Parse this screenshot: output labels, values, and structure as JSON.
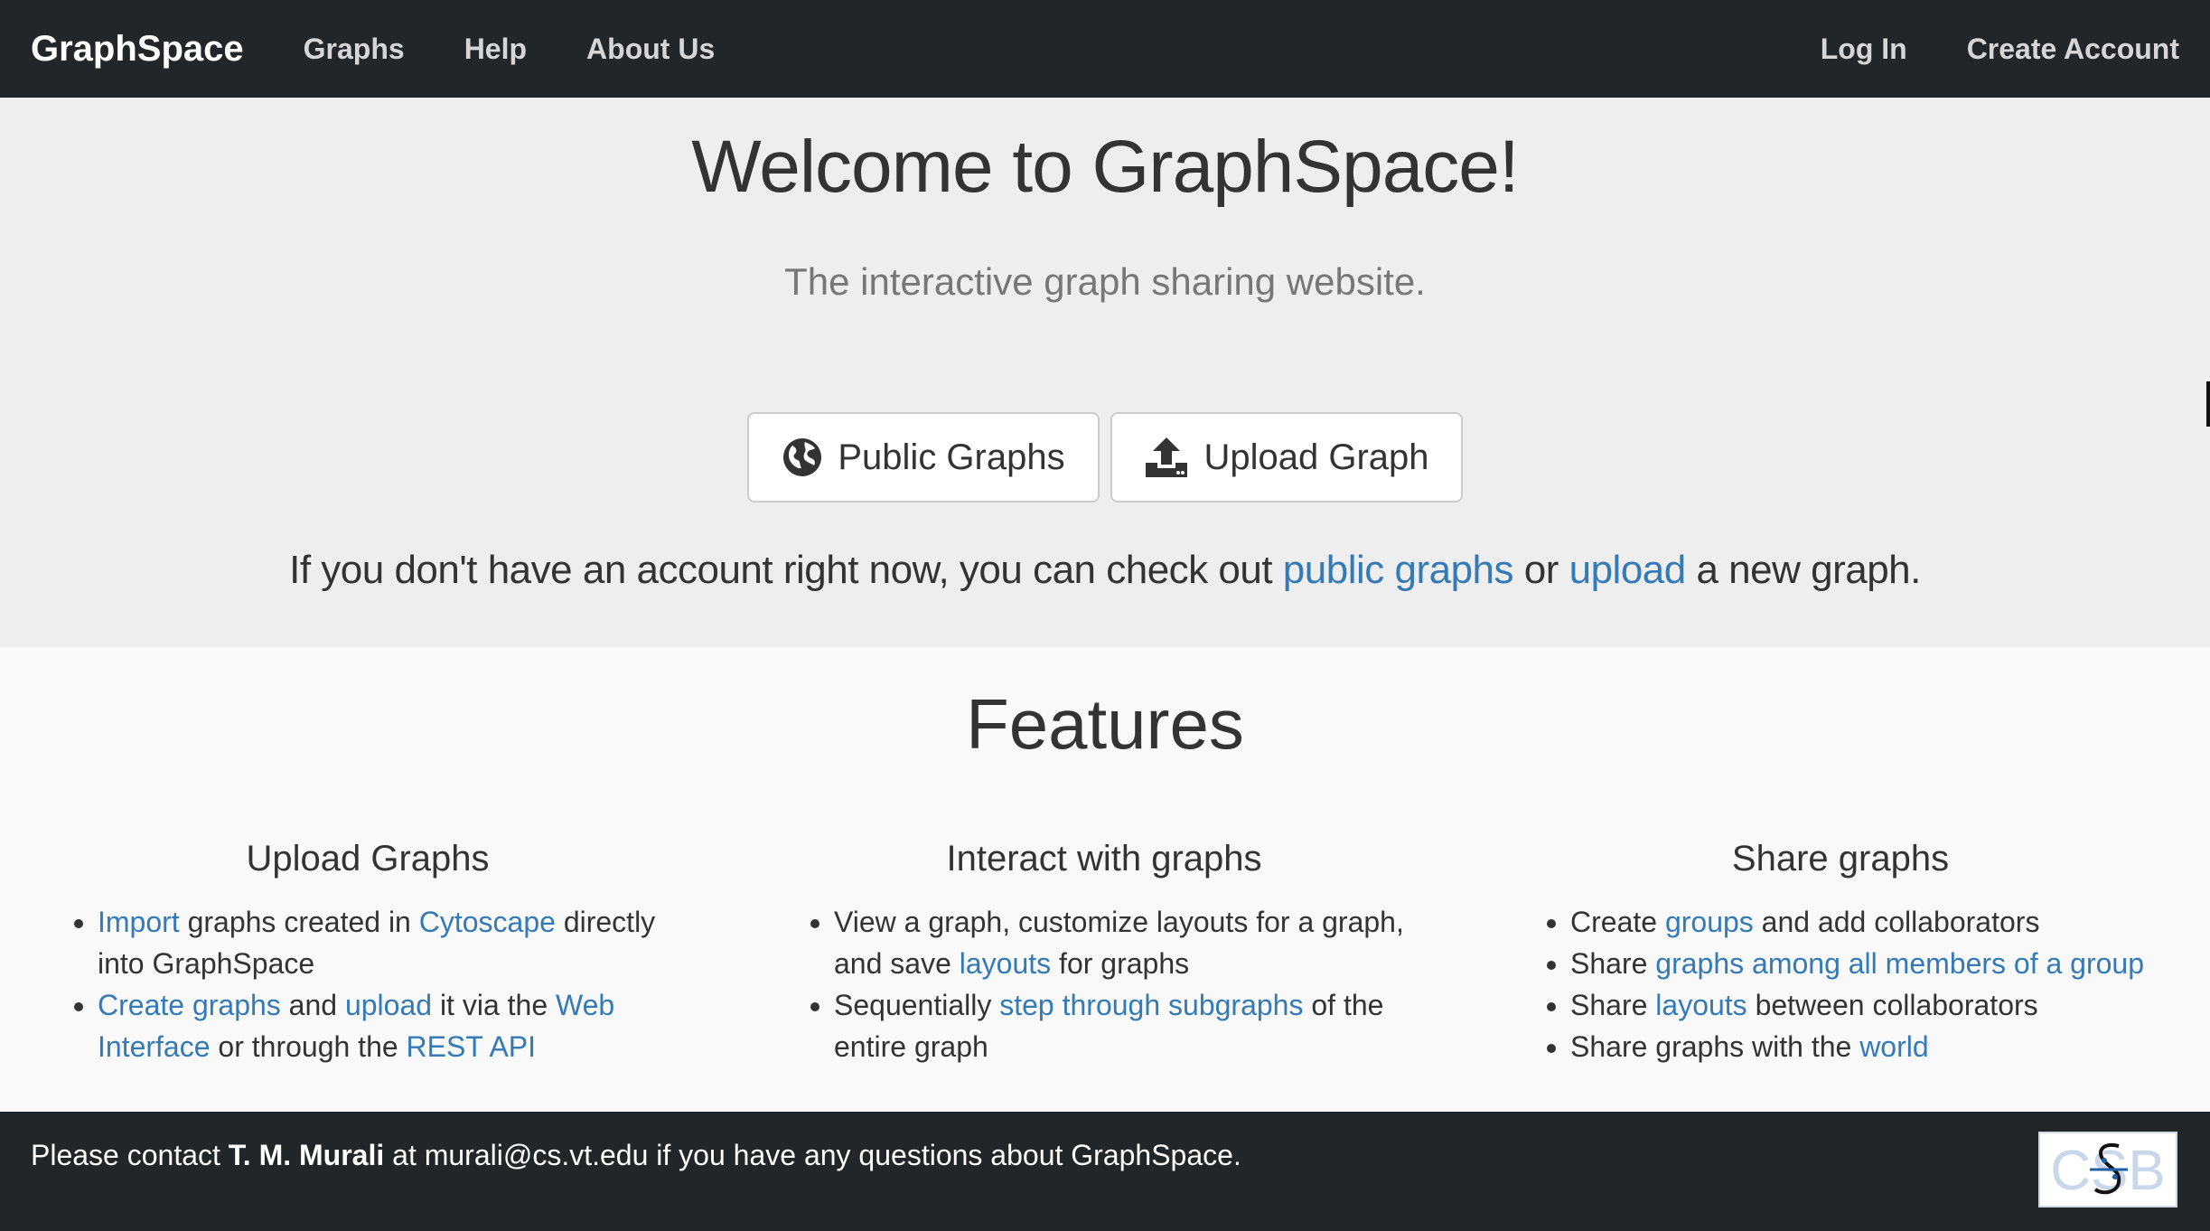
{
  "navbar": {
    "brand": "GraphSpace",
    "links": [
      "Graphs",
      "Help",
      "About Us"
    ],
    "login": "Log In",
    "create_account": "Create Account"
  },
  "hero": {
    "title": "Welcome to GraphSpace!",
    "subtitle": "The interactive graph sharing website.",
    "public_graphs_button": "Public Graphs",
    "upload_graph_button": "Upload Graph",
    "note": {
      "before": "If you don't have an account right now, you can check out ",
      "link1": "public graphs",
      "middle": " or ",
      "link2": "upload",
      "after": " a new graph."
    }
  },
  "features": {
    "title": "Features",
    "upload": {
      "heading": "Upload Graphs",
      "item1": {
        "link1": "Import",
        "text1": " graphs created in ",
        "link2": "Cytoscape",
        "text2": " directly into GraphSpace"
      },
      "item2": {
        "link1": "Create graphs",
        "text1": " and ",
        "link2": "upload",
        "text2": " it via the ",
        "link3": "Web Interface",
        "text3": " or through the ",
        "link4": "REST API"
      }
    },
    "interact": {
      "heading": "Interact with graphs",
      "item1": {
        "text1": "View a graph, customize layouts for a graph, and save ",
        "link1": "layouts",
        "text2": " for graphs"
      },
      "item2": {
        "text1": "Sequentially ",
        "link1": "step through subgraphs",
        "text2": " of the entire graph"
      }
    },
    "share": {
      "heading": "Share graphs",
      "item1": {
        "text1": "Create ",
        "link1": "groups",
        "text2": " and add collaborators"
      },
      "item2": {
        "text1": "Share ",
        "link1": "graphs among all members of a group"
      },
      "item3": {
        "text1": "Share ",
        "link1": "layouts",
        "text2": " between collaborators"
      },
      "item4": {
        "text1": "Share graphs with the ",
        "link1": "world"
      }
    }
  },
  "footer": {
    "before": "Please contact ",
    "name": "T. M. Murali",
    "after": " at murali@cs.vt.edu if you have any questions about GraphSpace.",
    "logo_text": "CSB"
  },
  "icons": {
    "public_graphs": "globe-icon",
    "upload_graph": "upload-icon"
  },
  "colors": {
    "navbar": "#222629",
    "hero_bg": "#eeeeee",
    "link": "#337ab7"
  }
}
